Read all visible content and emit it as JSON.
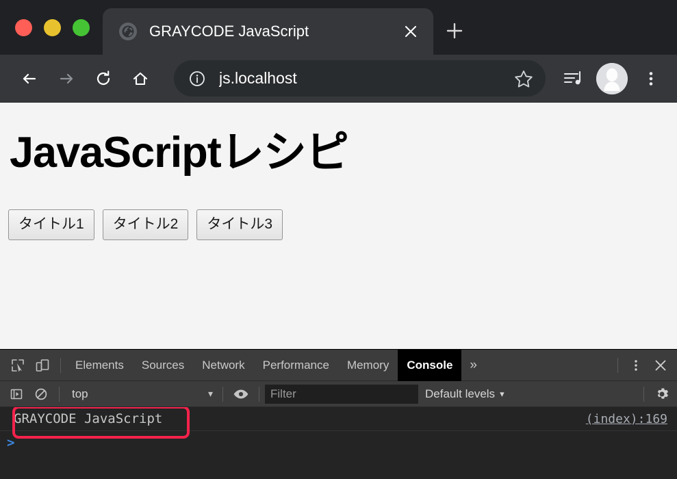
{
  "window": {
    "controls": [
      {
        "name": "close",
        "color": "#FF5F57"
      },
      {
        "name": "minimize",
        "color": "#E8C22E"
      },
      {
        "name": "maximize",
        "color": "#45C335"
      }
    ]
  },
  "tabstrip": {
    "tab_title": "GRAYCODE JavaScript",
    "favicon": "globe-icon",
    "close_label": "×",
    "new_tab_label": "+"
  },
  "toolbar": {
    "back": "←",
    "forward": "→",
    "reload": "⟳",
    "home": "⌂",
    "url": "js.localhost",
    "security_icon": "info-circle-icon",
    "bookmark_icon": "star-icon",
    "media_icon": "media-playlist-icon",
    "profile_icon": "avatar-icon",
    "menu_icon": "three-dot-menu-icon"
  },
  "page": {
    "heading": "JavaScriptレシピ",
    "buttons": [
      {
        "label": "タイトル1"
      },
      {
        "label": "タイトル2"
      },
      {
        "label": "タイトル3"
      }
    ]
  },
  "devtools": {
    "inspect_icon": "inspect-element-icon",
    "device_icon": "device-toolbar-icon",
    "tabs": [
      {
        "label": "Elements",
        "active": false
      },
      {
        "label": "Sources",
        "active": false
      },
      {
        "label": "Network",
        "active": false
      },
      {
        "label": "Performance",
        "active": false
      },
      {
        "label": "Memory",
        "active": false
      },
      {
        "label": "Console",
        "active": true
      }
    ],
    "more_tabs_label": "»",
    "settings_menu_icon": "three-dot-menu-icon",
    "close_label": "✕",
    "console_toolbar": {
      "sidebar_icon": "console-sidebar-icon",
      "clear_icon": "clear-console-icon",
      "context": "top",
      "context_caret": "▾",
      "eye_icon": "live-expression-icon",
      "filter_placeholder": "Filter",
      "filter_value": "",
      "levels_label": "Default levels",
      "levels_caret": "▾",
      "gear_icon": "settings-gear-icon"
    },
    "console_logs": [
      {
        "text": "GRAYCODE JavaScript",
        "source": "(index):169",
        "highlighted": true
      }
    ],
    "prompt": ">",
    "highlight_color": "#F4224B"
  }
}
